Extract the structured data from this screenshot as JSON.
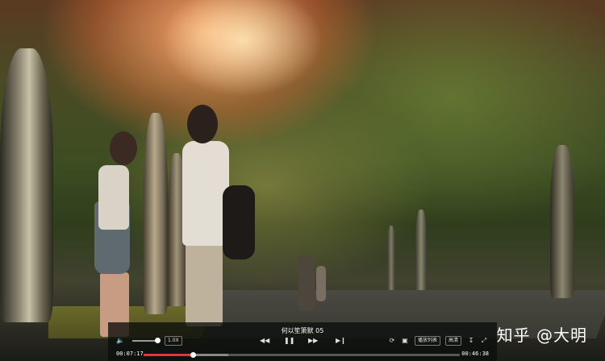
{
  "player": {
    "video_title": "何以笙箫默 05",
    "time_current": "00:07:17",
    "time_duration": "00:46:38",
    "progress": 0.156,
    "buffered": 0.268,
    "volume": 0.85,
    "speed_label": "1.0X",
    "list_label": "播放列表",
    "quality_label": "高清",
    "icons": {
      "volume": "volume-icon",
      "prev": "rewind-icon",
      "play": "pause-icon",
      "next": "fast-forward-icon",
      "end": "skip-end-icon",
      "loop": "loop-icon",
      "subtitle": "subtitle-icon",
      "download": "download-icon",
      "fullscreen": "fullscreen-icon"
    },
    "colors": {
      "played": "#e3343c",
      "bar_bg": "#0c0e0c"
    }
  },
  "watermark": "知乎 @大明"
}
